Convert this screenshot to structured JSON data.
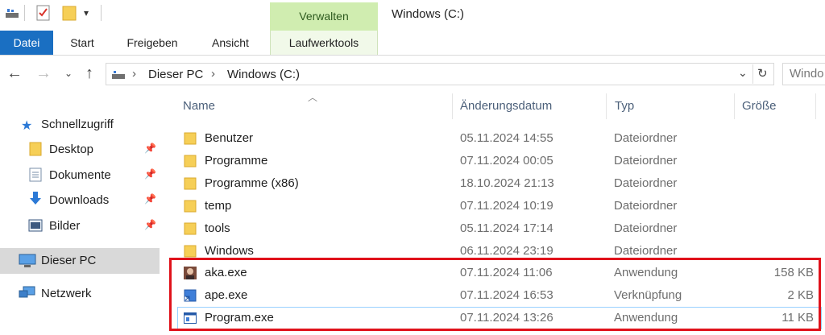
{
  "titlebar": {
    "context_group": "Verwalten",
    "window_title": "Windows (C:)"
  },
  "ribbon": {
    "tabs": [
      {
        "label": "Datei"
      },
      {
        "label": "Start"
      },
      {
        "label": "Freigeben"
      },
      {
        "label": "Ansicht"
      },
      {
        "label": "Laufwerktools"
      }
    ]
  },
  "address": {
    "crumbs": [
      "Dieser PC",
      "Windows (C:)"
    ],
    "search_placeholder": "Windo"
  },
  "navpane": {
    "quick_access": "Schnellzugriff",
    "items": [
      {
        "label": "Desktop"
      },
      {
        "label": "Dokumente"
      },
      {
        "label": "Downloads"
      },
      {
        "label": "Bilder"
      }
    ],
    "this_pc": "Dieser PC",
    "network": "Netzwerk"
  },
  "columns": {
    "name": "Name",
    "date": "Änderungsdatum",
    "type": "Typ",
    "size": "Größe"
  },
  "files": [
    {
      "name": "Benutzer",
      "date": "05.11.2024 14:55",
      "type": "Dateiordner",
      "size": "",
      "icon": "folder-icon"
    },
    {
      "name": "Programme",
      "date": "07.11.2024 00:05",
      "type": "Dateiordner",
      "size": "",
      "icon": "folder-icon"
    },
    {
      "name": "Programme (x86)",
      "date": "18.10.2024 21:13",
      "type": "Dateiordner",
      "size": "",
      "icon": "folder-icon"
    },
    {
      "name": "temp",
      "date": "07.11.2024 10:19",
      "type": "Dateiordner",
      "size": "",
      "icon": "folder-icon"
    },
    {
      "name": "tools",
      "date": "05.11.2024 17:14",
      "type": "Dateiordner",
      "size": "",
      "icon": "folder-icon"
    },
    {
      "name": "Windows",
      "date": "06.11.2024 23:19",
      "type": "Dateiordner",
      "size": "",
      "icon": "folder-icon"
    },
    {
      "name": "aka.exe",
      "date": "07.11.2024 11:06",
      "type": "Anwendung",
      "size": "158 KB",
      "icon": "app-image-icon"
    },
    {
      "name": "ape.exe",
      "date": "07.11.2024 16:53",
      "type": "Verknüpfung",
      "size": "2 KB",
      "icon": "shortcut-icon"
    },
    {
      "name": "Program.exe",
      "date": "07.11.2024 13:26",
      "type": "Anwendung",
      "size": "11 KB",
      "icon": "application-window-icon"
    }
  ],
  "colors": {
    "file_tab": "#1a6fc2",
    "context_group": "#d0edb0",
    "folder": "#f6cf57",
    "highlight": "#e0121b"
  }
}
